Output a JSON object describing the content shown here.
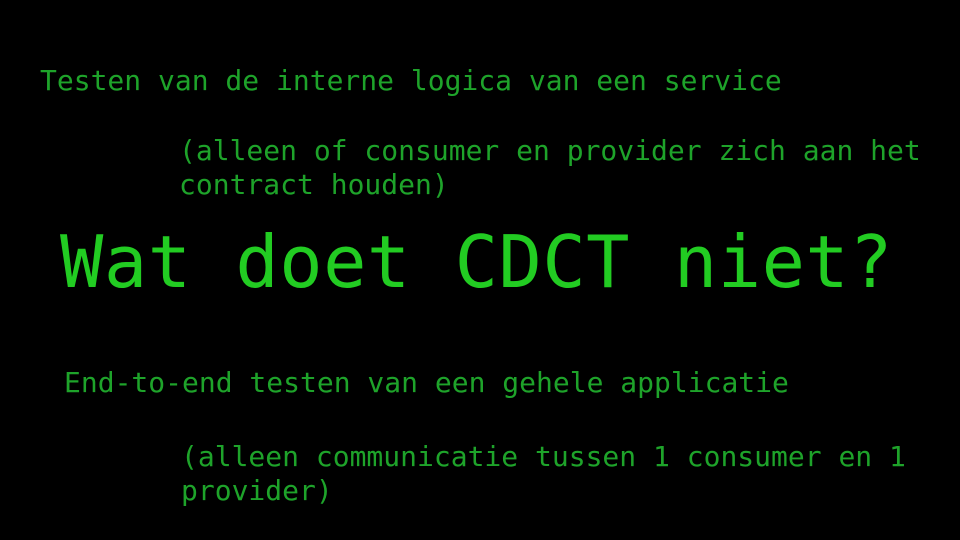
{
  "slide": {
    "background_color": "#000000",
    "body_text_color": "#1ea32a",
    "headline_color": "#22cc22",
    "lines": {
      "intro": "Testen van de interne logica van een service",
      "intro_note": "(alleen of consumer en provider zich aan het contract houden)",
      "headline": "Wat doet CDCT niet?",
      "second": "End-to-end testen van een gehele applicatie",
      "second_note": "(alleen communicatie tussen 1 consumer en 1 provider)"
    }
  }
}
